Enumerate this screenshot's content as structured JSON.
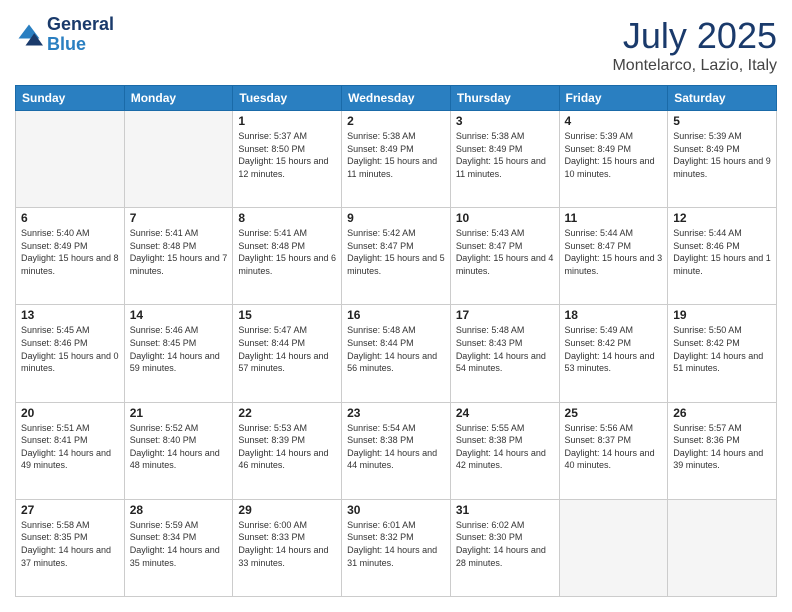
{
  "header": {
    "logo_line1": "General",
    "logo_line2": "Blue",
    "month": "July 2025",
    "location": "Montelarco, Lazio, Italy"
  },
  "weekdays": [
    "Sunday",
    "Monday",
    "Tuesday",
    "Wednesday",
    "Thursday",
    "Friday",
    "Saturday"
  ],
  "weeks": [
    [
      {
        "day": "",
        "empty": true
      },
      {
        "day": "",
        "empty": true
      },
      {
        "day": "1",
        "sunrise": "5:37 AM",
        "sunset": "8:50 PM",
        "daylight": "15 hours and 12 minutes."
      },
      {
        "day": "2",
        "sunrise": "5:38 AM",
        "sunset": "8:49 PM",
        "daylight": "15 hours and 11 minutes."
      },
      {
        "day": "3",
        "sunrise": "5:38 AM",
        "sunset": "8:49 PM",
        "daylight": "15 hours and 11 minutes."
      },
      {
        "day": "4",
        "sunrise": "5:39 AM",
        "sunset": "8:49 PM",
        "daylight": "15 hours and 10 minutes."
      },
      {
        "day": "5",
        "sunrise": "5:39 AM",
        "sunset": "8:49 PM",
        "daylight": "15 hours and 9 minutes."
      }
    ],
    [
      {
        "day": "6",
        "sunrise": "5:40 AM",
        "sunset": "8:49 PM",
        "daylight": "15 hours and 8 minutes."
      },
      {
        "day": "7",
        "sunrise": "5:41 AM",
        "sunset": "8:48 PM",
        "daylight": "15 hours and 7 minutes."
      },
      {
        "day": "8",
        "sunrise": "5:41 AM",
        "sunset": "8:48 PM",
        "daylight": "15 hours and 6 minutes."
      },
      {
        "day": "9",
        "sunrise": "5:42 AM",
        "sunset": "8:47 PM",
        "daylight": "15 hours and 5 minutes."
      },
      {
        "day": "10",
        "sunrise": "5:43 AM",
        "sunset": "8:47 PM",
        "daylight": "15 hours and 4 minutes."
      },
      {
        "day": "11",
        "sunrise": "5:44 AM",
        "sunset": "8:47 PM",
        "daylight": "15 hours and 3 minutes."
      },
      {
        "day": "12",
        "sunrise": "5:44 AM",
        "sunset": "8:46 PM",
        "daylight": "15 hours and 1 minute."
      }
    ],
    [
      {
        "day": "13",
        "sunrise": "5:45 AM",
        "sunset": "8:46 PM",
        "daylight": "15 hours and 0 minutes."
      },
      {
        "day": "14",
        "sunrise": "5:46 AM",
        "sunset": "8:45 PM",
        "daylight": "14 hours and 59 minutes."
      },
      {
        "day": "15",
        "sunrise": "5:47 AM",
        "sunset": "8:44 PM",
        "daylight": "14 hours and 57 minutes."
      },
      {
        "day": "16",
        "sunrise": "5:48 AM",
        "sunset": "8:44 PM",
        "daylight": "14 hours and 56 minutes."
      },
      {
        "day": "17",
        "sunrise": "5:48 AM",
        "sunset": "8:43 PM",
        "daylight": "14 hours and 54 minutes."
      },
      {
        "day": "18",
        "sunrise": "5:49 AM",
        "sunset": "8:42 PM",
        "daylight": "14 hours and 53 minutes."
      },
      {
        "day": "19",
        "sunrise": "5:50 AM",
        "sunset": "8:42 PM",
        "daylight": "14 hours and 51 minutes."
      }
    ],
    [
      {
        "day": "20",
        "sunrise": "5:51 AM",
        "sunset": "8:41 PM",
        "daylight": "14 hours and 49 minutes."
      },
      {
        "day": "21",
        "sunrise": "5:52 AM",
        "sunset": "8:40 PM",
        "daylight": "14 hours and 48 minutes."
      },
      {
        "day": "22",
        "sunrise": "5:53 AM",
        "sunset": "8:39 PM",
        "daylight": "14 hours and 46 minutes."
      },
      {
        "day": "23",
        "sunrise": "5:54 AM",
        "sunset": "8:38 PM",
        "daylight": "14 hours and 44 minutes."
      },
      {
        "day": "24",
        "sunrise": "5:55 AM",
        "sunset": "8:38 PM",
        "daylight": "14 hours and 42 minutes."
      },
      {
        "day": "25",
        "sunrise": "5:56 AM",
        "sunset": "8:37 PM",
        "daylight": "14 hours and 40 minutes."
      },
      {
        "day": "26",
        "sunrise": "5:57 AM",
        "sunset": "8:36 PM",
        "daylight": "14 hours and 39 minutes."
      }
    ],
    [
      {
        "day": "27",
        "sunrise": "5:58 AM",
        "sunset": "8:35 PM",
        "daylight": "14 hours and 37 minutes."
      },
      {
        "day": "28",
        "sunrise": "5:59 AM",
        "sunset": "8:34 PM",
        "daylight": "14 hours and 35 minutes."
      },
      {
        "day": "29",
        "sunrise": "6:00 AM",
        "sunset": "8:33 PM",
        "daylight": "14 hours and 33 minutes."
      },
      {
        "day": "30",
        "sunrise": "6:01 AM",
        "sunset": "8:32 PM",
        "daylight": "14 hours and 31 minutes."
      },
      {
        "day": "31",
        "sunrise": "6:02 AM",
        "sunset": "8:30 PM",
        "daylight": "14 hours and 28 minutes."
      },
      {
        "day": "",
        "empty": true
      },
      {
        "day": "",
        "empty": true
      }
    ]
  ]
}
